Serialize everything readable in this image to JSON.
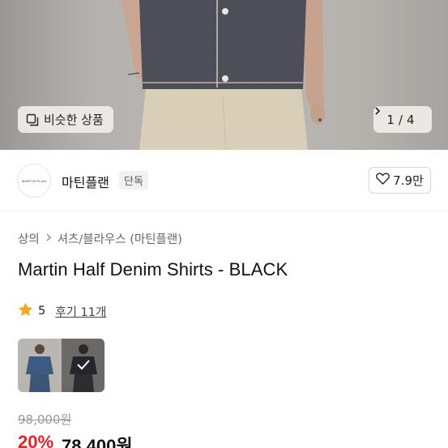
{
  "hero": {
    "similar_label": "비슷한 상품",
    "counter_current": "1",
    "counter_sep": "/",
    "counter_total": "4"
  },
  "shop": {
    "logo_text": "MARTIN PLAN",
    "name": "마틴플랜",
    "badge": "단독",
    "likes": "7.9만"
  },
  "product": {
    "breadcrumb": [
      "상의",
      "셔츠/블라우스 (마틴플랜)"
    ],
    "title": "Martin Half Denim Shirts - BLACK",
    "rating": "5",
    "reviews": "후기 11개",
    "original_price": "98,000원",
    "discount": "20%",
    "sale_price": "78,400원"
  },
  "colors": {
    "discount": "#e8202a",
    "star": "#f5a623"
  }
}
